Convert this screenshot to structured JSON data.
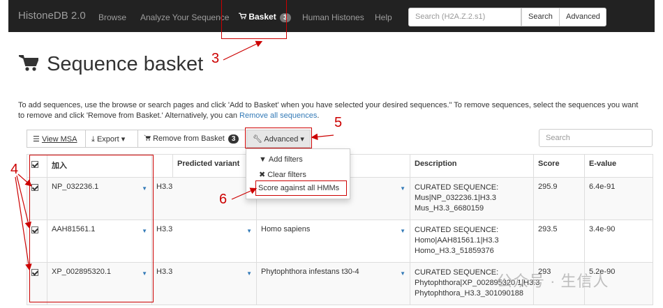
{
  "navbar": {
    "brand": "HistoneDB 2.0",
    "links": [
      "Browse",
      "Analyze Your Sequence",
      "Human Histones",
      "Help"
    ],
    "basket_label": "Basket",
    "basket_count": "3",
    "search_placeholder": "Search (H2A.Z.2.s1)",
    "search_button": "Search",
    "advanced_button": "Advanced"
  },
  "page": {
    "title": "Sequence basket",
    "intro_text": "To add sequences, use the browse or search pages and click 'Add to Basket' when you have selected your desired sequences.\" To remove sequences, select the sequences you want to remove and click 'Remove from Basket.' Alternatively, you can ",
    "intro_link": "Remove all sequences",
    "intro_end": "."
  },
  "toolbar": {
    "view_msa": "View MSA",
    "export": "Export",
    "remove": "Remove from Basket",
    "remove_count": "3",
    "advanced": "Advanced",
    "search_placeholder": "Search"
  },
  "dropdown": {
    "items": [
      "Add filters",
      "Clear filters",
      "Score against all HMMs"
    ]
  },
  "table": {
    "headers": [
      "",
      "加入",
      "",
      "Predicted variant",
      "",
      "Description",
      "Score",
      "E-value"
    ],
    "rows": [
      {
        "accession": "NP_032236.1",
        "variant": "H3.3",
        "organism": "",
        "description": "CURATED SEQUENCE: Mus|NP_032236.1|H3.3 Mus_H3.3_6680159",
        "score": "295.9",
        "evalue": "6.4e-91"
      },
      {
        "accession": "AAH81561.1",
        "variant": "H3.3",
        "organism": "Homo sapiens",
        "description": "CURATED SEQUENCE: Homo|AAH81561.1|H3.3 Homo_H3.3_51859376",
        "score": "293.5",
        "evalue": "3.4e-90"
      },
      {
        "accession": "XP_002895320.1",
        "variant": "H3.3",
        "organism": "Phytophthora infestans t30-4",
        "description": "CURATED SEQUENCE: Phytophthora|XP_002895320.1|H3.3 Phytophthora_H3.3_301090188",
        "score": "293",
        "evalue": "5.2e-90"
      }
    ]
  },
  "annotations": {
    "n3": "3",
    "n4": "4",
    "n5": "5",
    "n6": "6",
    "color": "#cc0000"
  },
  "watermark": "公众号 · 生信人"
}
